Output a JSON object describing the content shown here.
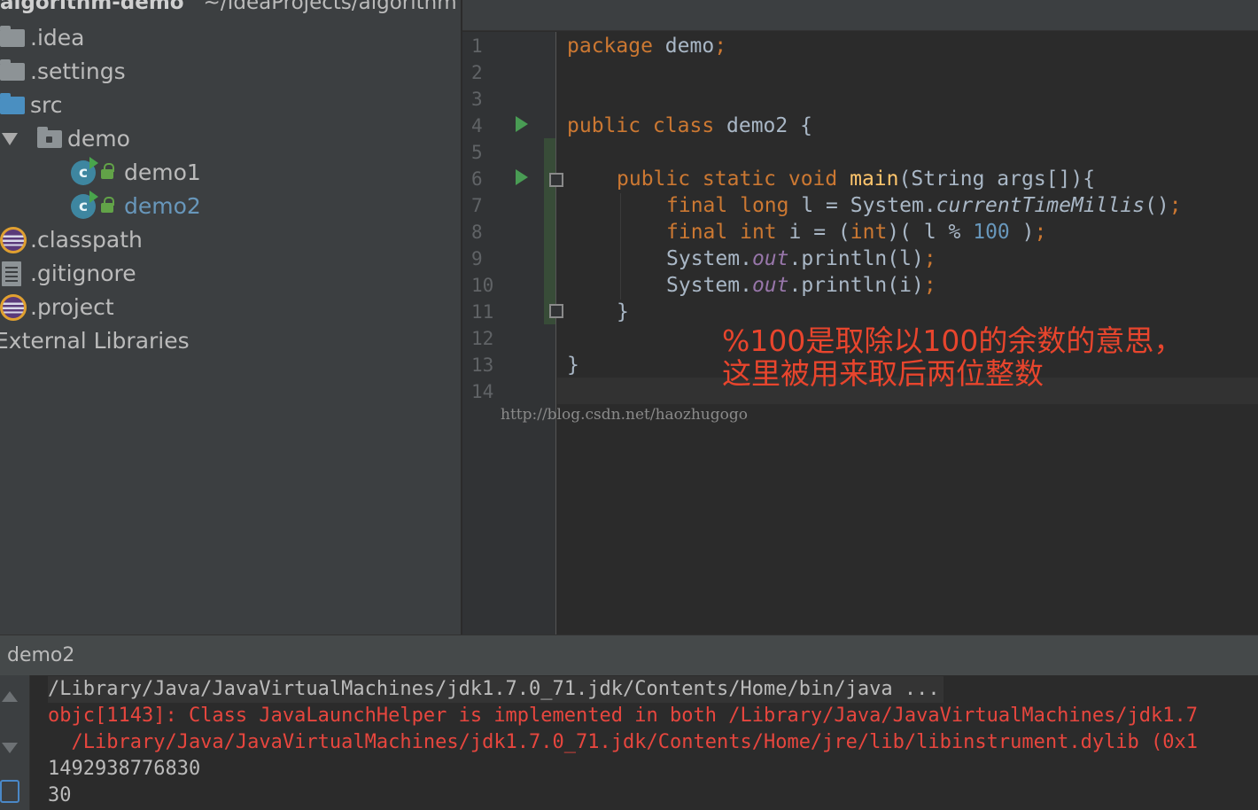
{
  "project": {
    "header_name": "algorithm-demo",
    "header_path": "~/IdeaProjects/algorithm",
    "items": [
      {
        "label": ".idea",
        "icon": "folder-icon"
      },
      {
        "label": ".settings",
        "icon": "folder-icon"
      },
      {
        "label": "src",
        "icon": "source-folder-icon"
      },
      {
        "label": "demo",
        "icon": "package-icon"
      },
      {
        "label": "demo1",
        "icon": "java-class-icon"
      },
      {
        "label": "demo2",
        "icon": "java-class-icon"
      },
      {
        "label": ".classpath",
        "icon": "eclipse-icon"
      },
      {
        "label": ".gitignore",
        "icon": "text-file-icon"
      },
      {
        "label": ".project",
        "icon": "eclipse-icon"
      },
      {
        "label": "External Libraries",
        "icon": "library-icon"
      }
    ]
  },
  "editor": {
    "line_numbers": [
      "1",
      "2",
      "3",
      "4",
      "5",
      "6",
      "7",
      "8",
      "9",
      "10",
      "11",
      "12",
      "13",
      "14"
    ],
    "code": {
      "l1_kw": "package",
      "l1_rest": " demo",
      "l1_semi": ";",
      "l4_kw": "public class",
      "l4_rest": " demo2 {",
      "l6_kw": "public static void",
      "l6_fn": "main",
      "l6_rest": "(String args[]){",
      "l7_kw1": "final",
      "l7_kw2": "long",
      "l7_a": " l = System.",
      "l7_call": "currentTimeMillis",
      "l7_b": "()",
      "l7_semi": ";",
      "l8_kw1": "final",
      "l8_kw2": "int",
      "l8_a": " i = (",
      "l8_kw3": "int",
      "l8_b": ")( l % ",
      "l8_num": "100",
      "l8_c": " )",
      "l8_semi": ";",
      "l9_a": "System.",
      "l9_fld": "out",
      "l9_b": ".println(l)",
      "l9_semi": ";",
      "l10_a": "System.",
      "l10_fld": "out",
      "l10_b": ".println(i)",
      "l10_semi": ";",
      "l11": "}",
      "l13": "}"
    },
    "annotation_line1": "%100是取除以100的余数的意思，",
    "annotation_line2": "这里被用来取后两位整数",
    "watermark": "http://blog.csdn.net/haozhugogo",
    "colors": {
      "keyword": "#cc7832",
      "method": "#ffc66d",
      "number": "#6897bb",
      "field": "#9876aa",
      "annotation": "#e8452d"
    }
  },
  "run": {
    "title": "demo2",
    "console": [
      "/Library/Java/JavaVirtualMachines/jdk1.7.0_71.jdk/Contents/Home/bin/java ...",
      "objc[1143]: Class JavaLaunchHelper is implemented in both /Library/Java/JavaVirtualMachines/jdk1.7",
      "  /Library/Java/JavaVirtualMachines/jdk1.7.0_71.jdk/Contents/Home/jre/lib/libinstrument.dylib (0x1",
      "1492938776830",
      "30"
    ],
    "colors": {
      "error": "#e7463e"
    }
  }
}
